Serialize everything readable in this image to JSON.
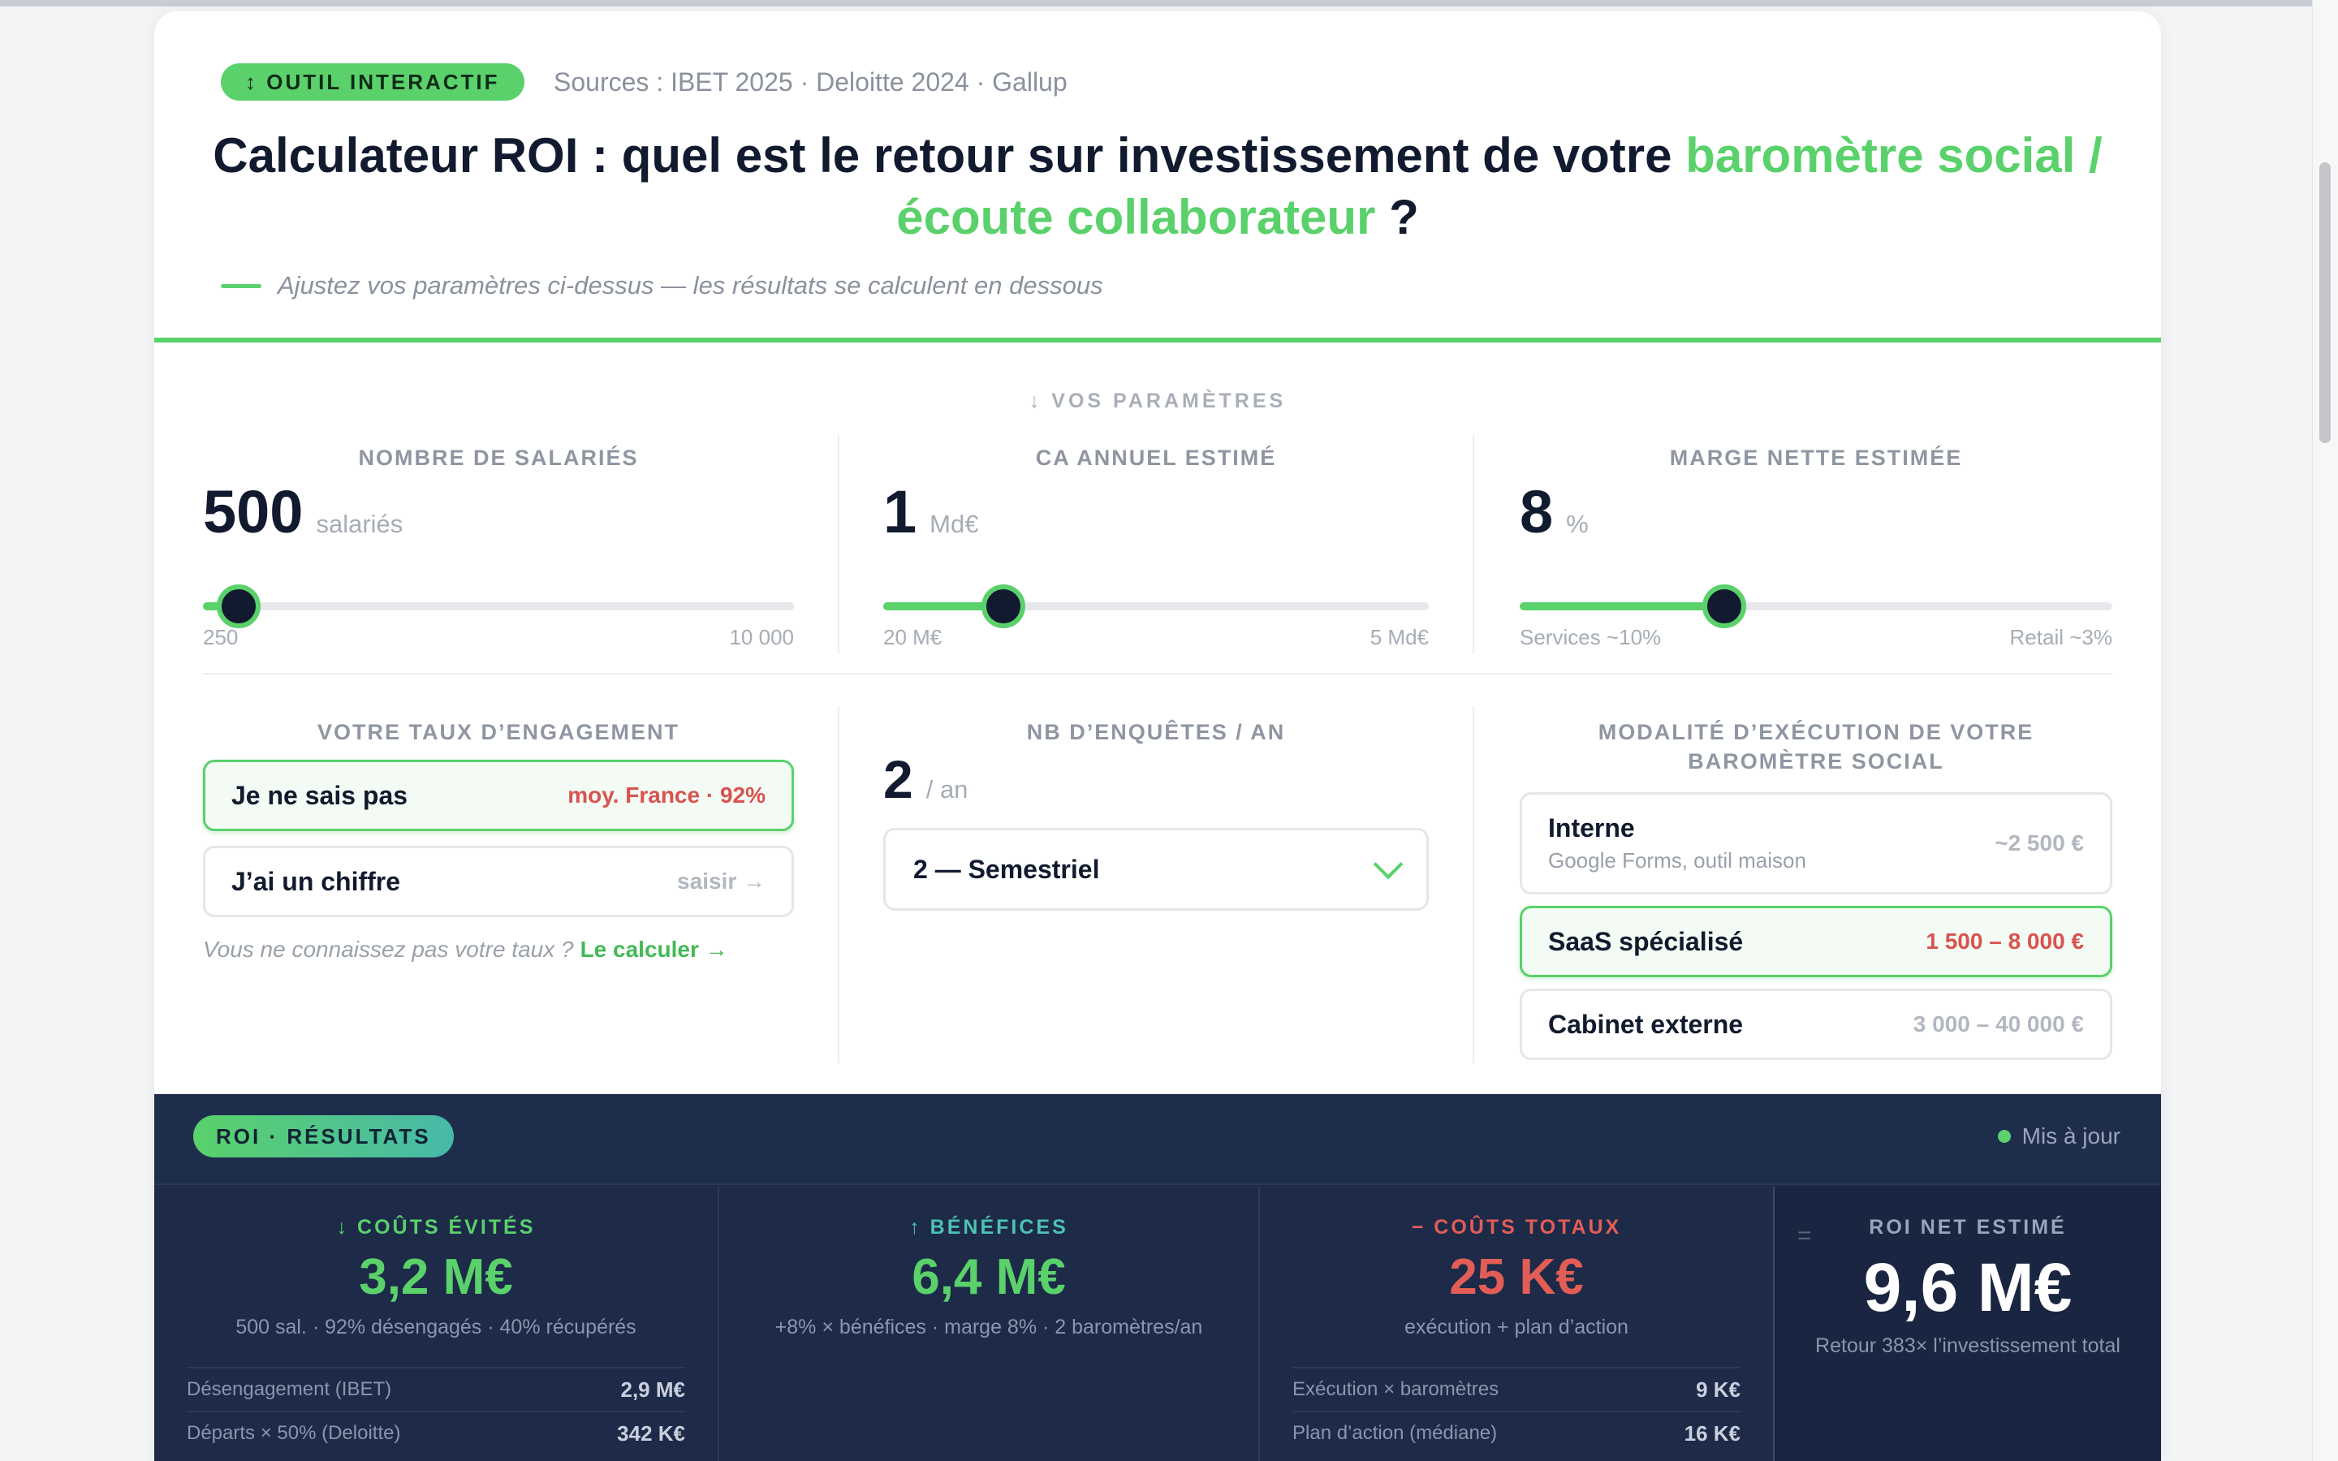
{
  "header": {
    "pill": "↕ OUTIL INTERACTIF",
    "sources": "Sources : IBET 2025 · Deloitte 2024 · Gallup",
    "title_main": "Calculateur ROI : quel est le retour sur investissement de votre ",
    "title_highlight": "baromètre social / écoute collaborateur",
    "title_end": " ?",
    "subtitle": "Ajustez vos paramètres ci-dessus — les résultats se calculent en dessous"
  },
  "params": {
    "section_label": "↓ VOS PARAMÈTRES",
    "employees": {
      "label": "NOMBRE DE SALARIÉS",
      "value": "500",
      "unit": "salariés",
      "min": "250",
      "max": "10 000",
      "slider_fraction": 0.06
    },
    "revenue": {
      "label": "CA ANNUEL ESTIMÉ",
      "value": "1",
      "unit": "Md€",
      "min": "20 M€",
      "max": "5 Md€",
      "slider_fraction": 0.22
    },
    "margin": {
      "label": "MARGE NETTE ESTIMÉE",
      "value": "8",
      "unit": "%",
      "min": "Services ~10%",
      "max": "Retail ~3%",
      "slider_fraction": 0.345
    },
    "engagement": {
      "label": "VOTRE TAUX D’ENGAGEMENT",
      "option1_label": "Je ne sais pas",
      "option1_right": "moy. France · 92%",
      "option2_label": "J’ai un chiffre",
      "option2_right": "saisir →",
      "hint": "Vous ne connaissez pas votre taux ?",
      "hint_link": "Le calculer →"
    },
    "surveys": {
      "label": "NB D’ENQUÊTES / AN",
      "value": "2",
      "unit": "/ an",
      "selected": "2 — Semestriel"
    },
    "modality": {
      "label_line1": "MODALITÉ D’EXÉCUTION DE VOTRE",
      "label_line2": "BAROMÈTRE SOCIAL",
      "options": [
        {
          "label": "Interne",
          "sub": "Google Forms, outil maison",
          "price": "~2 500 €"
        },
        {
          "label": "SaaS spécialisé",
          "price": "1 500 – 8 000 €"
        },
        {
          "label": "Cabinet externe",
          "price": "3 000 – 40 000 €"
        }
      ]
    }
  },
  "results": {
    "pill": "ROI · RÉSULTATS",
    "updated": "Mis à jour",
    "avoided": {
      "label": "↓ COÛTS ÉVITÉS",
      "value": "3,2 M€",
      "note": "500 sal. · 92% désengagés · 40% récupérés",
      "row1_label": "Désengagement (IBET)",
      "row1_value": "2,9 M€",
      "row2_label": "Départs × 50% (Deloitte)",
      "row2_value": "342 K€"
    },
    "benefits": {
      "label": "↑ BÉNÉFICES",
      "value": "6,4 M€",
      "note": "+8% × bénéfices · marge 8% · 2 baromètres/an"
    },
    "costs": {
      "label": "− COÛTS TOTAUX",
      "value": "25 K€",
      "note": "exécution + plan d’action",
      "row1_label": "Exécution × baromètres",
      "row1_value": "9 K€",
      "row2_label": "Plan d’action (médiane)",
      "row2_value": "16 K€"
    },
    "roi": {
      "eq": "=",
      "label": "ROI NET ESTIMÉ",
      "value": "9,6 M€",
      "note": "Retour 383× l’investissement total"
    }
  }
}
